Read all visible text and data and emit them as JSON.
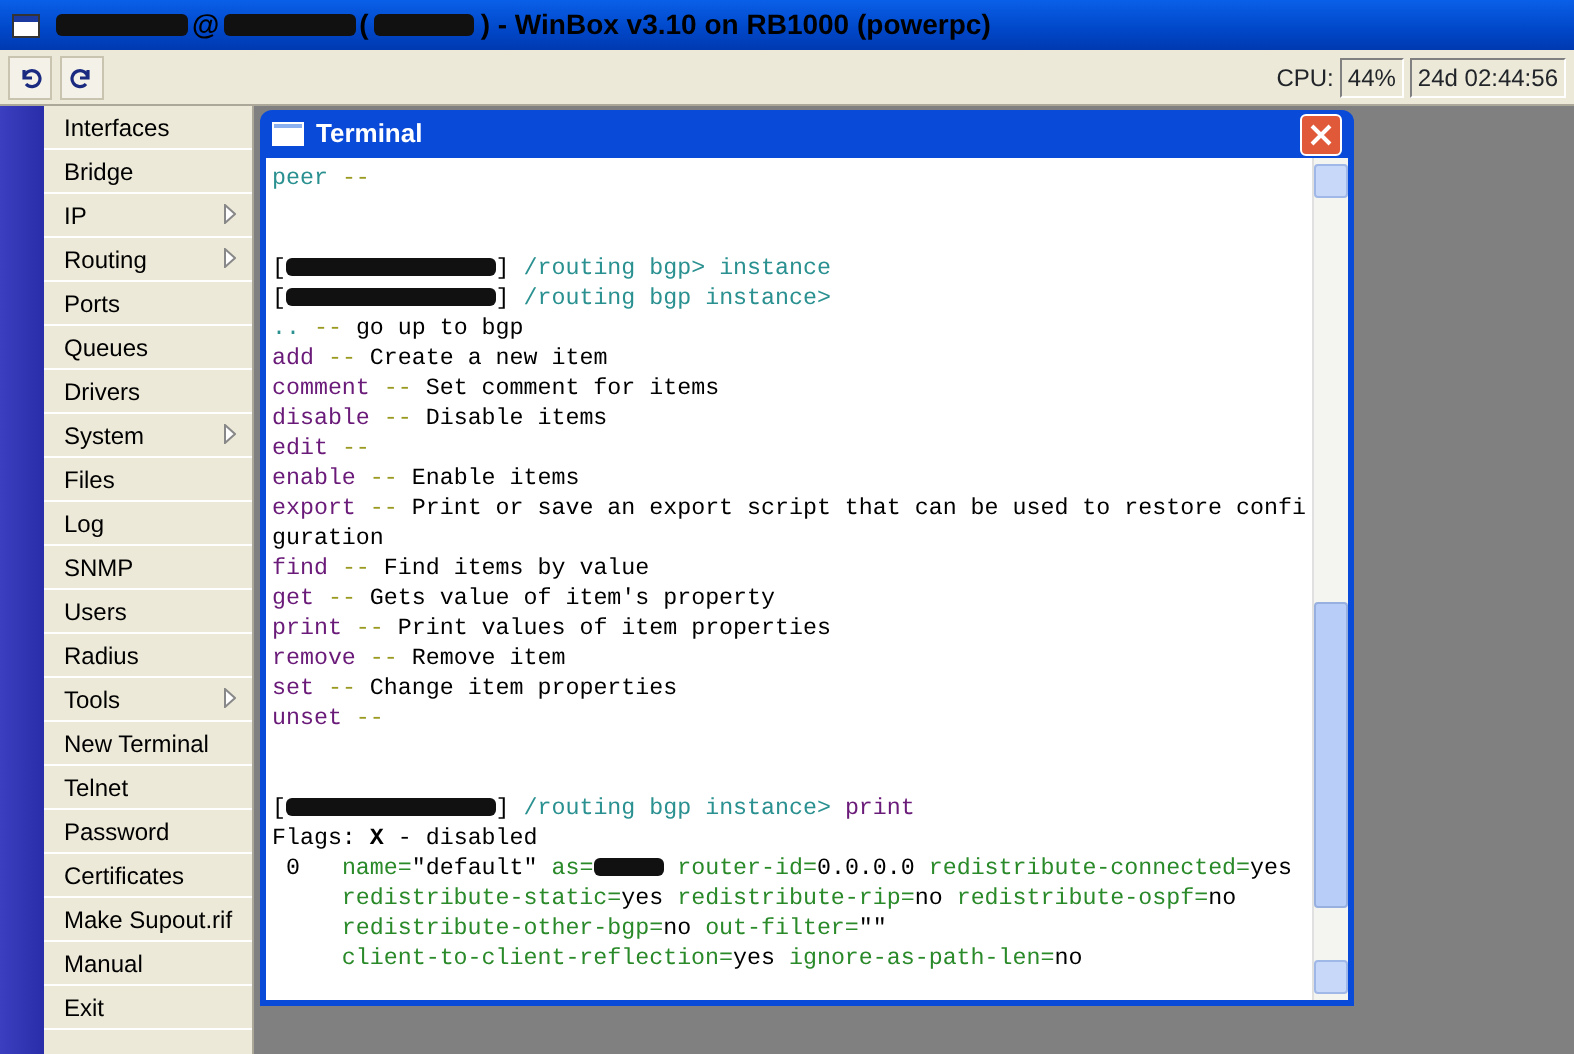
{
  "window": {
    "title": [
      {
        "kind": "redacted"
      },
      {
        "kind": "plain",
        "text": "@"
      },
      {
        "kind": "redacted"
      },
      {
        "kind": "plain",
        "text": "("
      },
      {
        "kind": "blot"
      },
      {
        "kind": "plain",
        "text": ") - WinBox v3.10 on RB1000 (powerpc)"
      }
    ]
  },
  "toolbar": {
    "cpu_label": "CPU:",
    "cpu": "44%",
    "uptime": "24d 02:44:56"
  },
  "menu": [
    {
      "label": "Interfaces",
      "submenu": false
    },
    {
      "label": "Bridge",
      "submenu": false
    },
    {
      "label": "IP",
      "submenu": true
    },
    {
      "label": "Routing",
      "submenu": true
    },
    {
      "label": "Ports",
      "submenu": false
    },
    {
      "label": "Queues",
      "submenu": false
    },
    {
      "label": "Drivers",
      "submenu": false
    },
    {
      "label": "System",
      "submenu": true
    },
    {
      "label": "Files",
      "submenu": false
    },
    {
      "label": "Log",
      "submenu": false
    },
    {
      "label": "SNMP",
      "submenu": false
    },
    {
      "label": "Users",
      "submenu": false
    },
    {
      "label": "Radius",
      "submenu": false
    },
    {
      "label": "Tools",
      "submenu": true
    },
    {
      "label": "New Terminal",
      "submenu": false
    },
    {
      "label": "Telnet",
      "submenu": false
    },
    {
      "label": "Password",
      "submenu": false
    },
    {
      "label": "Certificates",
      "submenu": false
    },
    {
      "label": "Make Supout.rif",
      "submenu": false
    },
    {
      "label": "Manual",
      "submenu": false
    },
    {
      "label": "Exit",
      "submenu": false
    }
  ],
  "terminal": {
    "title": "Terminal",
    "blocks": [
      [
        [
          {
            "kind": "cmd",
            "text": "peer"
          },
          {
            "kind": "sep",
            "text": " --"
          }
        ]
      ],
      [
        [
          {
            "kind": "plain",
            "text": "["
          },
          {
            "kind": "redacted"
          },
          {
            "kind": "plain",
            "text": "]"
          },
          {
            "kind": "cmd",
            "text": " /routing bgp> instance"
          }
        ],
        [
          {
            "kind": "plain",
            "text": "["
          },
          {
            "kind": "redacted"
          },
          {
            "kind": "plain",
            "text": "]"
          },
          {
            "kind": "cmd",
            "text": " /routing bgp instance>"
          }
        ],
        [
          {
            "kind": "cmd",
            "text": ".."
          },
          {
            "kind": "sep",
            "text": " -- "
          },
          {
            "kind": "plain",
            "text": "go up to bgp"
          }
        ],
        [
          {
            "kind": "keyword",
            "text": "add"
          },
          {
            "kind": "sep",
            "text": " -- "
          },
          {
            "kind": "plain",
            "text": "Create a new item"
          }
        ],
        [
          {
            "kind": "keyword",
            "text": "comment"
          },
          {
            "kind": "sep",
            "text": " -- "
          },
          {
            "kind": "plain",
            "text": "Set comment for items"
          }
        ],
        [
          {
            "kind": "keyword",
            "text": "disable"
          },
          {
            "kind": "sep",
            "text": " -- "
          },
          {
            "kind": "plain",
            "text": "Disable items"
          }
        ],
        [
          {
            "kind": "keyword",
            "text": "edit"
          },
          {
            "kind": "sep",
            "text": " --"
          }
        ],
        [
          {
            "kind": "keyword",
            "text": "enable"
          },
          {
            "kind": "sep",
            "text": " -- "
          },
          {
            "kind": "plain",
            "text": "Enable items"
          }
        ],
        [
          {
            "kind": "keyword",
            "text": "export"
          },
          {
            "kind": "sep",
            "text": " -- "
          },
          {
            "kind": "plain",
            "text": "Print or save an export script that can be used to restore confi"
          }
        ],
        [
          {
            "kind": "plain",
            "text": "guration"
          }
        ],
        [
          {
            "kind": "keyword",
            "text": "find"
          },
          {
            "kind": "sep",
            "text": " -- "
          },
          {
            "kind": "plain",
            "text": "Find items by value"
          }
        ],
        [
          {
            "kind": "keyword",
            "text": "get"
          },
          {
            "kind": "sep",
            "text": " -- "
          },
          {
            "kind": "plain",
            "text": "Gets value of item's property"
          }
        ],
        [
          {
            "kind": "keyword",
            "text": "print"
          },
          {
            "kind": "sep",
            "text": " -- "
          },
          {
            "kind": "plain",
            "text": "Print values of item properties"
          }
        ],
        [
          {
            "kind": "keyword",
            "text": "remove"
          },
          {
            "kind": "sep",
            "text": " -- "
          },
          {
            "kind": "plain",
            "text": "Remove item"
          }
        ],
        [
          {
            "kind": "keyword",
            "text": "set"
          },
          {
            "kind": "sep",
            "text": " -- "
          },
          {
            "kind": "plain",
            "text": "Change item properties"
          }
        ],
        [
          {
            "kind": "keyword",
            "text": "unset"
          },
          {
            "kind": "sep",
            "text": " --"
          }
        ]
      ],
      [
        [
          {
            "kind": "plain",
            "text": "["
          },
          {
            "kind": "redacted"
          },
          {
            "kind": "plain",
            "text": "]"
          },
          {
            "kind": "cmd",
            "text": " /routing bgp instance> "
          },
          {
            "kind": "keyword",
            "text": "print"
          }
        ],
        [
          {
            "kind": "plain",
            "text": "Flags: **X** - disabled"
          }
        ],
        [
          {
            "kind": "plain",
            "text": " 0   "
          },
          {
            "kind": "attr",
            "text": "name="
          },
          {
            "kind": "plain",
            "text": "\"default\" "
          },
          {
            "kind": "attr",
            "text": "as="
          },
          {
            "kind": "blot"
          },
          {
            "kind": "attr",
            "text": " router-id="
          },
          {
            "kind": "plain",
            "text": "0.0.0.0 "
          },
          {
            "kind": "attr",
            "text": "redistribute-connected="
          },
          {
            "kind": "plain",
            "text": "yes"
          }
        ],
        [
          {
            "kind": "indent"
          },
          {
            "kind": "attr",
            "text": "redistribute-static="
          },
          {
            "kind": "plain",
            "text": "yes "
          },
          {
            "kind": "attr",
            "text": "redistribute-rip="
          },
          {
            "kind": "plain",
            "text": "no "
          },
          {
            "kind": "attr",
            "text": "redistribute-ospf="
          },
          {
            "kind": "plain",
            "text": "no"
          }
        ],
        [
          {
            "kind": "indent"
          },
          {
            "kind": "attr",
            "text": "redistribute-other-bgp="
          },
          {
            "kind": "plain",
            "text": "no "
          },
          {
            "kind": "attr",
            "text": "out-filter="
          },
          {
            "kind": "plain",
            "text": "\"\""
          }
        ],
        [
          {
            "kind": "indent"
          },
          {
            "kind": "attr",
            "text": "client-to-client-reflection="
          },
          {
            "kind": "plain",
            "text": "yes "
          },
          {
            "kind": "attr",
            "text": "ignore-as-path-len="
          },
          {
            "kind": "plain",
            "text": "no"
          }
        ]
      ]
    ]
  }
}
